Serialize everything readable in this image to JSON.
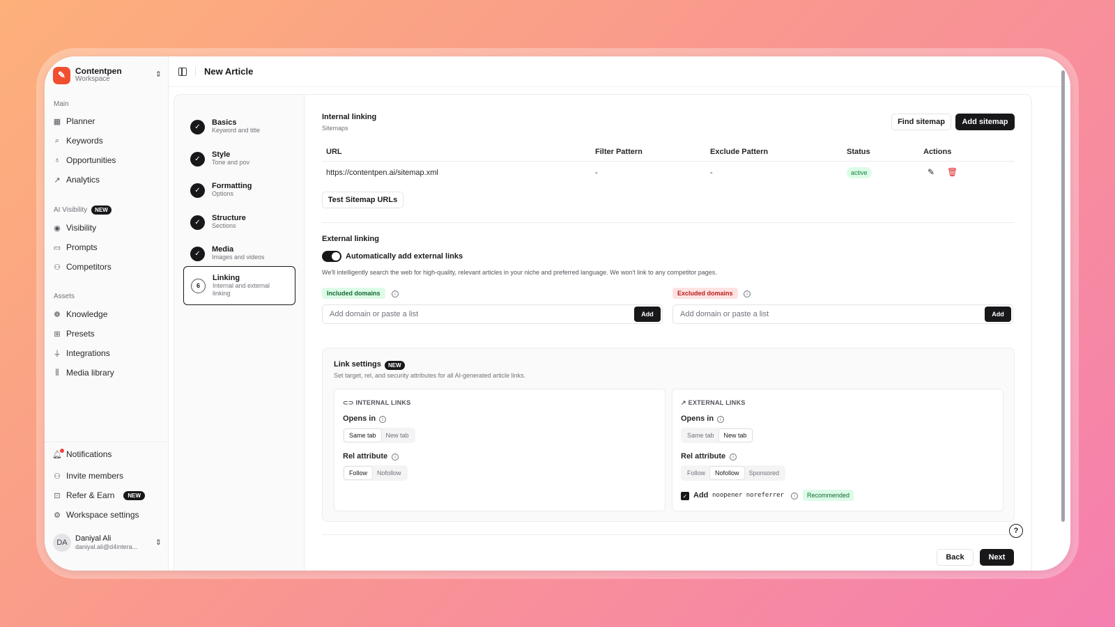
{
  "workspace": {
    "name": "Contentpen",
    "sub": "Workspace"
  },
  "sidebar": {
    "main_label": "Main",
    "main_items": [
      {
        "label": "Planner",
        "icon": "calendar-icon"
      },
      {
        "label": "Keywords",
        "icon": "search-icon"
      },
      {
        "label": "Opportunities",
        "icon": "lightbulb-icon"
      },
      {
        "label": "Analytics",
        "icon": "chart-icon"
      }
    ],
    "ai_label": "AI Visibility",
    "ai_badge": "NEW",
    "ai_items": [
      {
        "label": "Visibility",
        "icon": "eye-icon"
      },
      {
        "label": "Prompts",
        "icon": "message-icon"
      },
      {
        "label": "Competitors",
        "icon": "users-icon"
      }
    ],
    "assets_label": "Assets",
    "assets_items": [
      {
        "label": "Knowledge",
        "icon": "brain-icon"
      },
      {
        "label": "Presets",
        "icon": "grid-icon"
      },
      {
        "label": "Integrations",
        "icon": "plug-icon"
      },
      {
        "label": "Media library",
        "icon": "library-icon"
      }
    ],
    "bottom_items": [
      {
        "label": "Notifications",
        "icon": "bell-icon"
      },
      {
        "label": "Invite members",
        "icon": "user-plus-icon"
      },
      {
        "label": "Refer & Earn",
        "icon": "gift-icon",
        "badge": "NEW"
      },
      {
        "label": "Workspace settings",
        "icon": "gear-icon"
      }
    ],
    "user": {
      "initials": "DA",
      "name": "Daniyal Ali",
      "email": "daniyal.ali@d4intera..."
    }
  },
  "header": {
    "title": "New Article"
  },
  "steps": [
    {
      "title": "Basics",
      "sub": "Keyword and title",
      "state": "done"
    },
    {
      "title": "Style",
      "sub": "Tone and pov",
      "state": "done"
    },
    {
      "title": "Formatting",
      "sub": "Options",
      "state": "done"
    },
    {
      "title": "Structure",
      "sub": "Sections",
      "state": "done"
    },
    {
      "title": "Media",
      "sub": "Images and videos",
      "state": "done"
    },
    {
      "title": "Linking",
      "sub": "Internal and external",
      "sub2": "linking",
      "number": "6",
      "state": "active"
    }
  ],
  "internal": {
    "title": "Internal linking",
    "sub": "Sitemaps",
    "find_btn": "Find sitemap",
    "add_btn": "Add sitemap",
    "columns": [
      "URL",
      "Filter Pattern",
      "Exclude Pattern",
      "Status",
      "Actions"
    ],
    "rows": [
      {
        "url": "https://contentpen.ai/sitemap.xml",
        "filter": "-",
        "exclude": "-",
        "status": "active"
      }
    ],
    "test_btn": "Test Sitemap URLs"
  },
  "external": {
    "title": "External linking",
    "toggle_label": "Automatically add external links",
    "toggle_on": true,
    "desc": "We'll intelligently search the web for high-quality, relevant articles in your niche and preferred language. We won't link to any competitor pages.",
    "included_label": "Included domains",
    "excluded_label": "Excluded domains",
    "placeholder": "Add domain or paste a list",
    "add_label": "Add"
  },
  "link_settings": {
    "title": "Link settings",
    "badge": "NEW",
    "desc": "Set target, rel, and security attributes for all AI-generated article links.",
    "internal": {
      "title": "INTERNAL LINKS",
      "opens_label": "Opens in",
      "opens_options": [
        "Same tab",
        "New tab"
      ],
      "opens_selected": "Same tab",
      "rel_label": "Rel attribute",
      "rel_options": [
        "Follow",
        "Nofollow"
      ],
      "rel_selected": "Follow"
    },
    "external": {
      "title": "EXTERNAL LINKS",
      "opens_label": "Opens in",
      "opens_options": [
        "Same tab",
        "New tab"
      ],
      "opens_selected": "New tab",
      "rel_label": "Rel attribute",
      "rel_options": [
        "Follow",
        "Nofollow",
        "Sponsored"
      ],
      "rel_selected": "Nofollow",
      "add_label": "Add",
      "add_code": "noopener noreferrer",
      "recommended": "Recommended",
      "add_checked": true
    }
  },
  "footer": {
    "back": "Back",
    "next": "Next"
  },
  "help": "?"
}
